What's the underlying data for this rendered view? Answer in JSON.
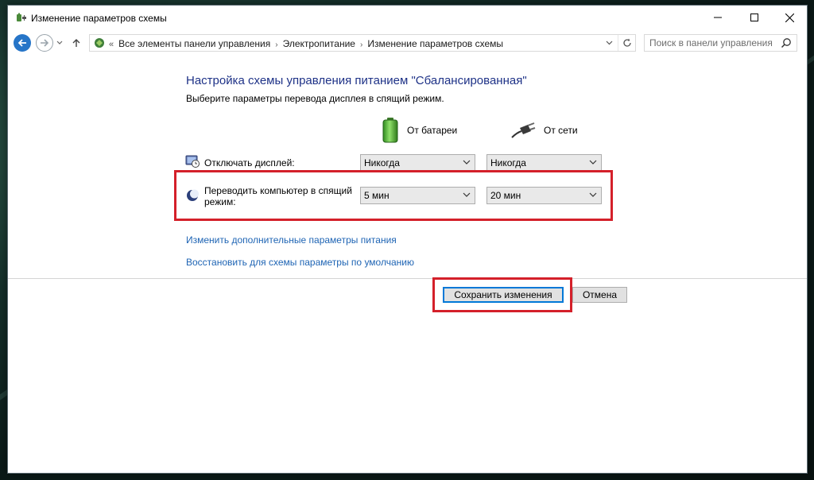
{
  "window": {
    "title": "Изменение параметров схемы"
  },
  "address": {
    "crumbs": [
      "Все элементы панели управления",
      "Электропитание",
      "Изменение параметров схемы"
    ],
    "search_placeholder": "Поиск в панели управления"
  },
  "main": {
    "heading": "Настройка схемы управления питанием \"Сбалансированная\"",
    "subheading": "Выберите параметры перевода дисплея в спящий режим.",
    "columns": {
      "battery": "От батареи",
      "plugged": "От сети"
    },
    "settings": [
      {
        "label": "Отключать дисплей:",
        "battery_value": "Никогда",
        "plugged_value": "Никогда"
      },
      {
        "label_line1": "Переводить компьютер в спящий",
        "label_line2": "режим:",
        "battery_value": "5 мин",
        "plugged_value": "20 мин"
      }
    ],
    "links": {
      "advanced": "Изменить дополнительные параметры питания",
      "restore": "Восстановить для схемы параметры по умолчанию"
    },
    "buttons": {
      "save": "Сохранить изменения",
      "cancel": "Отмена"
    }
  },
  "colors": {
    "heading": "#1e3287",
    "link": "#1e64b4",
    "highlight": "#d4202a",
    "accent": "#0078d7"
  }
}
